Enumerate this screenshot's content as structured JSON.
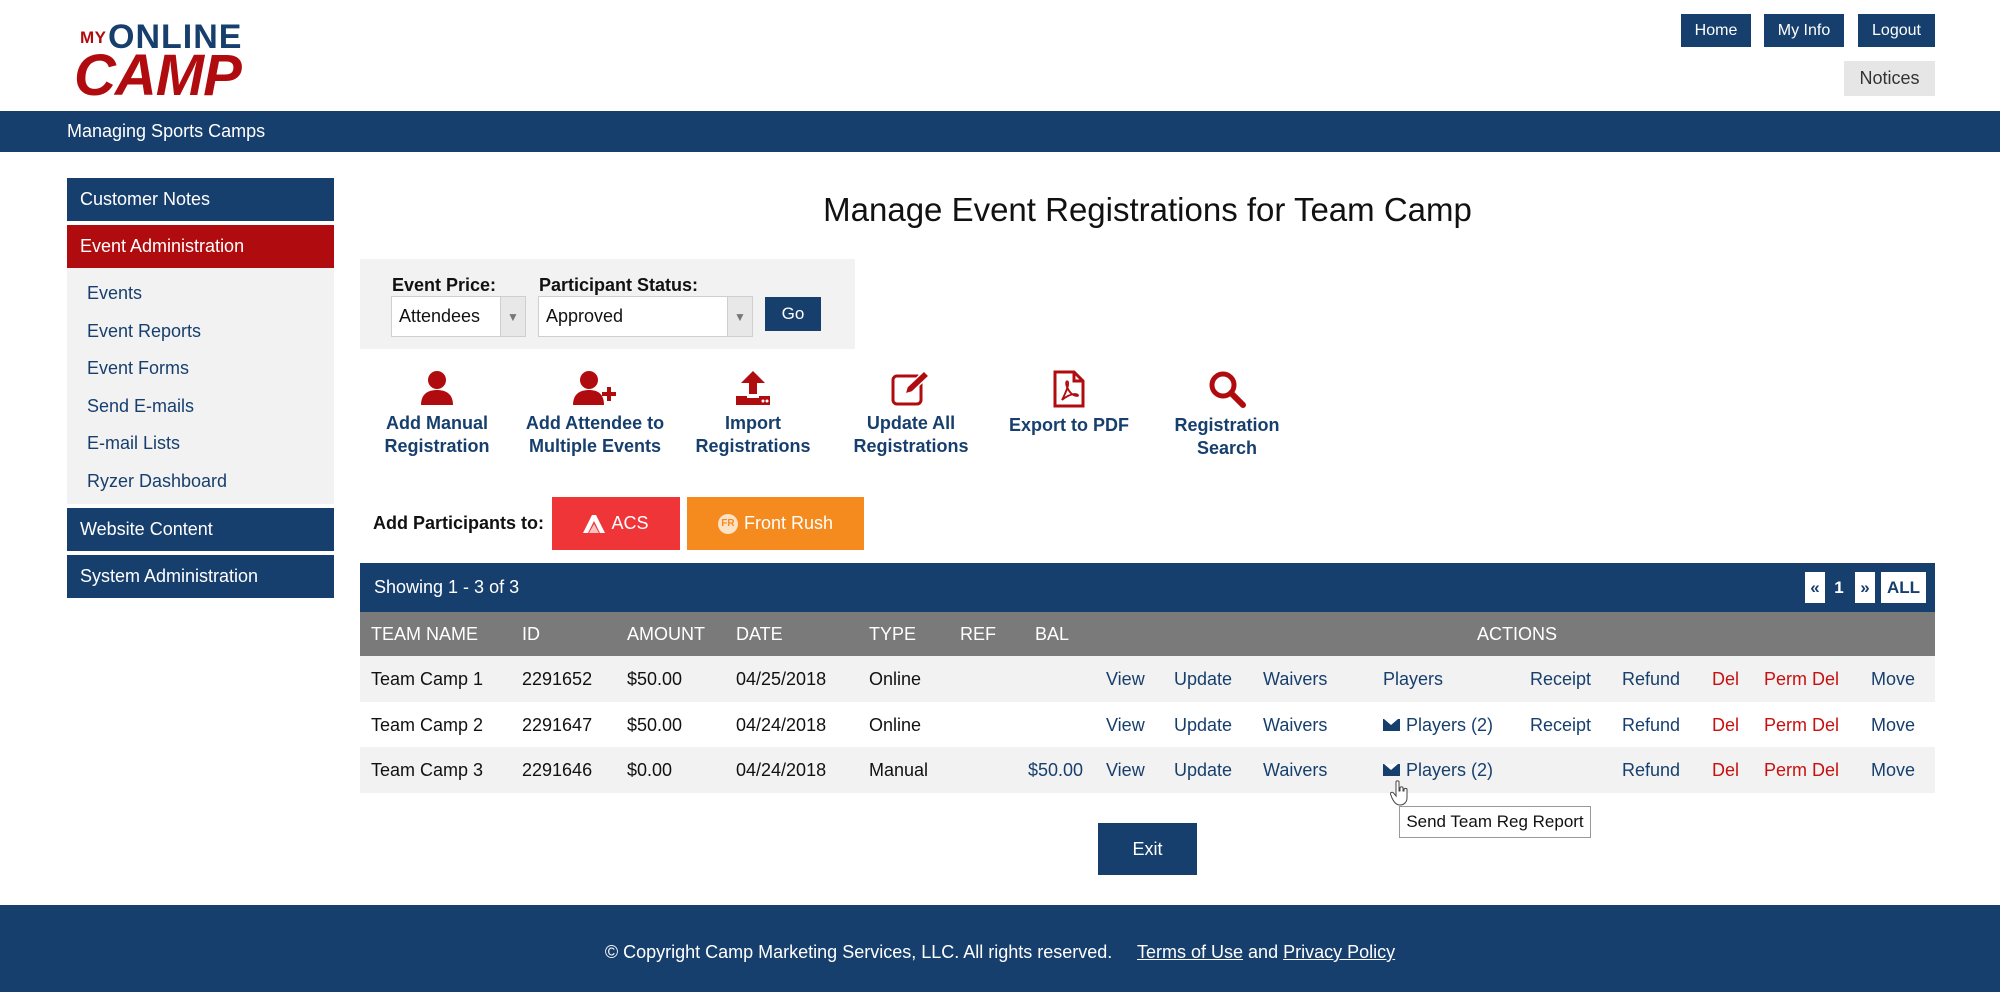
{
  "logo": {
    "my": "MY",
    "online": "ONLINE",
    "camp": "CAMP"
  },
  "header": {
    "home": "Home",
    "my_info": "My Info",
    "logout": "Logout",
    "notices": "Notices"
  },
  "banner": {
    "title": "Managing Sports Camps"
  },
  "sidebar": {
    "customer_notes": "Customer Notes",
    "event_admin": "Event Administration",
    "sub_items": [
      "Events",
      "Event Reports",
      "Event Forms",
      "Send E-mails",
      "E-mail Lists",
      "Ryzer Dashboard"
    ],
    "website_content": "Website Content",
    "system_admin": "System Administration"
  },
  "main": {
    "title": "Manage Event Registrations for Team Camp",
    "filters": {
      "event_price_label": "Event Price:",
      "event_price_value": "Attendees",
      "status_label": "Participant Status:",
      "status_value": "Approved",
      "go": "Go"
    },
    "actions": [
      {
        "label1": "Add Manual",
        "label2": "Registration",
        "icon": "user-icon"
      },
      {
        "label1": "Add Attendee to",
        "label2": "Multiple Events",
        "icon": "user-plus-icon"
      },
      {
        "label1": "Import",
        "label2": "Registrations",
        "icon": "upload-icon"
      },
      {
        "label1": "Update All",
        "label2": "Registrations",
        "icon": "edit-icon"
      },
      {
        "label1": "Export to PDF",
        "label2": "",
        "icon": "pdf-icon"
      },
      {
        "label1": "Registration",
        "label2": "Search",
        "icon": "search-icon"
      }
    ],
    "add_participants_label": "Add Participants to:",
    "acs": "ACS",
    "front_rush": "Front Rush",
    "front_rush_badge": "FR",
    "accent_red": "#b00c10",
    "accent_blue": "#173f6d"
  },
  "table": {
    "showing": "Showing 1 - 3 of 3",
    "pagination": {
      "prev": "«",
      "page": "1",
      "next": "»",
      "all": "ALL"
    },
    "headers": {
      "team": "TEAM NAME",
      "id": "ID",
      "amount": "AMOUNT",
      "date": "DATE",
      "type": "TYPE",
      "ref": "REF",
      "bal": "BAL",
      "actions": "ACTIONS"
    },
    "rows": [
      {
        "team": "Team Camp 1",
        "id": "2291652",
        "amount": "$50.00",
        "date": "04/25/2018",
        "type": "Online",
        "ref": "",
        "bal": "",
        "view": "View",
        "update": "Update",
        "waivers": "Waivers",
        "players": "Players",
        "receipt": "Receipt",
        "refund": "Refund",
        "del": "Del",
        "perm_del": "Perm Del",
        "move": "Move"
      },
      {
        "team": "Team Camp 2",
        "id": "2291647",
        "amount": "$50.00",
        "date": "04/24/2018",
        "type": "Online",
        "ref": "",
        "bal": "",
        "view": "View",
        "update": "Update",
        "waivers": "Waivers",
        "players": "Players (2)",
        "receipt": "Receipt",
        "refund": "Refund",
        "del": "Del",
        "perm_del": "Perm Del",
        "move": "Move"
      },
      {
        "team": "Team Camp 3",
        "id": "2291646",
        "amount": "$0.00",
        "date": "04/24/2018",
        "type": "Manual",
        "ref": "",
        "bal": "$50.00",
        "view": "View",
        "update": "Update",
        "waivers": "Waivers",
        "players": "Players (2)",
        "receipt": "",
        "refund": "Refund",
        "del": "Del",
        "perm_del": "Perm Del",
        "move": "Move"
      }
    ]
  },
  "tooltip": "Send Team Reg Report",
  "exit": "Exit",
  "footer": {
    "copyright": "© Copyright Camp Marketing Services, LLC. All rights reserved.",
    "terms": "Terms of Use",
    "and": "and",
    "privacy": "Privacy Policy"
  }
}
